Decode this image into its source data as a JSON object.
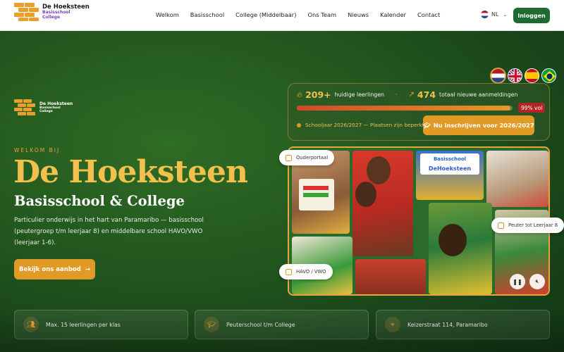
{
  "nav": {
    "logo_title": "De Hoeksteen",
    "logo_sub1": "Basisschool",
    "logo_sub2": "College",
    "items": [
      "Welkom",
      "Basisschool",
      "College (Middelbaar)",
      "Ons Team",
      "Nieuws",
      "Kalender",
      "Contact"
    ],
    "language": "NL",
    "login": "Inloggen"
  },
  "hero": {
    "welcome": "WELKOM BIJ",
    "title": "De Hoeksteen",
    "subtitle": "Basisschool & College",
    "description": "Particulier onderwijs in het hart van Paramaribo — basisschool (peutergroep t/m leerjaar 8) en middelbare school HAVO/VWO (leerjaar 1-6).",
    "cta": "Bekijk ons aanbod"
  },
  "stats": {
    "current_num": "209+",
    "current_label": "huidige leerlingen",
    "new_num": "474",
    "new_label": "totaal nieuwe aanmeldingen",
    "fill_percent": 99,
    "vol_badge": "99% vol",
    "year_text": "Schooljaar 2026/2027 — Plaatsen zijn beperkt!",
    "enroll": "Nu inschrijven voor 2026/2027"
  },
  "collage": {
    "tag_parent": "Ouderportaal",
    "tag_havo": "HAVO / VWO",
    "tag_peuter": "Peuter tot Leerjaar 8",
    "sign_line1": "Basisschool",
    "sign_line2": "DeHoeksteen"
  },
  "cards": [
    {
      "text": "Max. 15 leerlingen per klas",
      "icon": "users-icon"
    },
    {
      "text": "Peuterschool t/m College",
      "icon": "graduation-cap-icon"
    },
    {
      "text": "Keizerstraat 114, Paramaribo",
      "icon": "map-pin-icon"
    }
  ],
  "colors": {
    "accent": "#e29a27",
    "brand_green": "#1d6b32",
    "gold": "#f3c04e"
  }
}
